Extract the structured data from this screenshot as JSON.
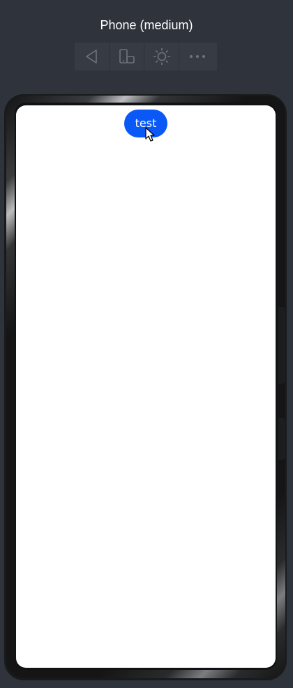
{
  "device": {
    "title": "Phone (medium)"
  },
  "toolbar": {
    "buttons": [
      {
        "name": "back",
        "icon": "back-triangle-icon"
      },
      {
        "name": "rotate-device",
        "icon": "rotate-device-icon"
      },
      {
        "name": "theme",
        "icon": "sun-icon"
      },
      {
        "name": "more",
        "icon": "more-dots-icon"
      }
    ]
  },
  "screen": {
    "button_label": "test"
  },
  "colors": {
    "background": "#2f333c",
    "toolbar": "#373b43",
    "icon": "#6e737d",
    "screen": "#ffffff",
    "accent": "#0a59f7",
    "frame": "#151516"
  }
}
